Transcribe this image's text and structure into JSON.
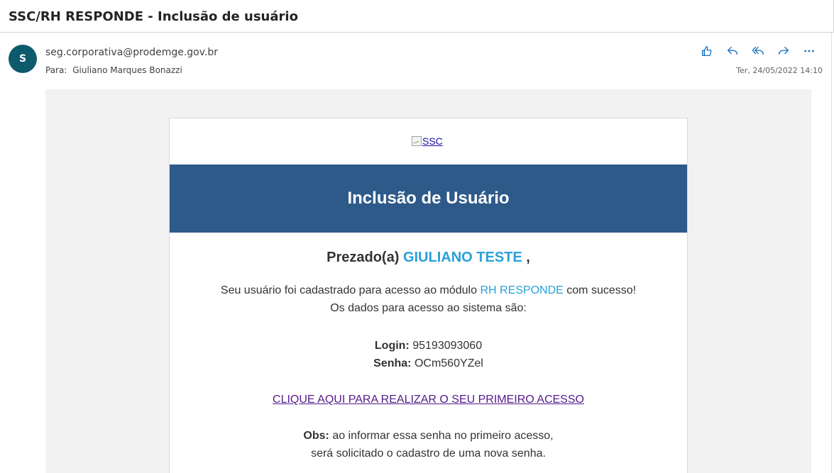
{
  "email": {
    "subject": "SSC/RH RESPONDE - Inclusão de usuário",
    "sender_initial": "S",
    "sender": "seg.corporativa@prodemge.gov.br",
    "to_label": "Para:",
    "to_name": "Giuliano Marques Bonazzi",
    "date": "Ter, 24/05/2022 14:10",
    "actions": [
      "like-icon",
      "reply-icon",
      "reply-all-icon",
      "forward-icon",
      "more-icon"
    ]
  },
  "body": {
    "logo_alt": "SSC",
    "banner_title": "Inclusão de Usuário",
    "greeting_prefix": "Prezado(a)",
    "user_name": "GIULIANO TESTE",
    "greeting_suffix": ",",
    "line1_prefix": "Seu usuário foi cadastrado para acesso ao módulo",
    "module": "RH RESPONDE",
    "line1_suffix": "com sucesso!",
    "line2": "Os dados para acesso ao sistema são:",
    "login_label": "Login:",
    "login_value": "95193093060",
    "senha_label": "Senha:",
    "senha_value": "OCm560YZel",
    "access_link": "CLIQUE AQUI PARA REALIZAR O SEU PRIMEIRO ACESSO",
    "obs_label": "Obs:",
    "obs_line1": "ao informar essa senha no primeiro acesso,",
    "obs_line2": "será solicitado o cadastro de uma nova senha."
  },
  "colors": {
    "banner": "#2e5a8a",
    "accent": "#2aa0d8",
    "avatar": "#0e5a6d",
    "action_icons": "#0f6cbd",
    "link_visited": "#551a8b"
  }
}
